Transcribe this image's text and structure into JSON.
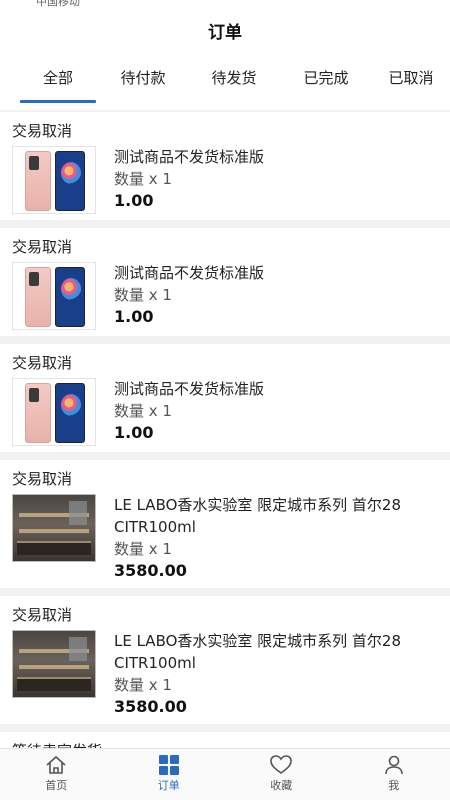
{
  "status_bar": {
    "carrier": "中国移动"
  },
  "header": {
    "title": "订单"
  },
  "tabs": [
    {
      "label": "全部",
      "active": true
    },
    {
      "label": "待付款",
      "active": false
    },
    {
      "label": "待发货",
      "active": false
    },
    {
      "label": "已完成",
      "active": false
    },
    {
      "label": "已取消",
      "active": false
    }
  ],
  "orders": [
    {
      "status": "交易取消",
      "title": "测试商品不发货标准版",
      "qty": "数量 x 1",
      "price": "1.00",
      "image": "phone-image"
    },
    {
      "status": "交易取消",
      "title": "测试商品不发货标准版",
      "qty": "数量 x 1",
      "price": "1.00",
      "image": "phone-image"
    },
    {
      "status": "交易取消",
      "title": "测试商品不发货标准版",
      "qty": "数量 x 1",
      "price": "1.00",
      "image": "phone-image"
    },
    {
      "status": "交易取消",
      "title": "LE LABO香水实验室 限定城市系列 首尔28 CITR100ml",
      "qty": "数量 x 1",
      "price": "3580.00",
      "image": "store-image"
    },
    {
      "status": "交易取消",
      "title": "LE LABO香水实验室 限定城市系列 首尔28 CITR100ml",
      "qty": "数量 x 1",
      "price": "3580.00",
      "image": "store-image"
    }
  ],
  "partial_order": {
    "status": "等待卖家发货"
  },
  "bottom_nav": [
    {
      "label": "首页",
      "icon": "home-icon",
      "active": false
    },
    {
      "label": "订单",
      "icon": "grid-icon",
      "active": true
    },
    {
      "label": "收藏",
      "icon": "heart-icon",
      "active": false
    },
    {
      "label": "我",
      "icon": "user-icon",
      "active": false
    }
  ],
  "colors": {
    "accent": "#2b6bbf",
    "background": "#f1f1f1"
  }
}
